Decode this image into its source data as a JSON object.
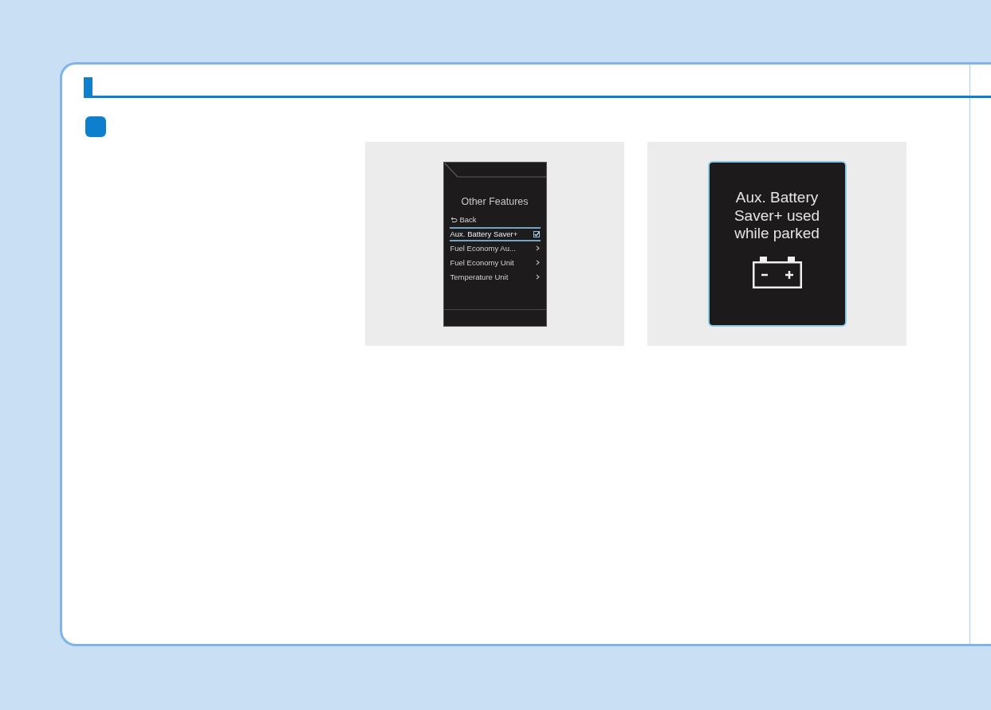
{
  "figures": [
    {
      "kind": "menu_screen",
      "title": "Other Features",
      "items": [
        {
          "kind": "back",
          "label": "Back",
          "selected": false
        },
        {
          "kind": "checkbox",
          "label": "Aux. Battery Saver+",
          "selected": true,
          "checked": true
        },
        {
          "kind": "submenu",
          "label": "Fuel Economy Au...",
          "selected": false
        },
        {
          "kind": "submenu",
          "label": "Fuel Economy Unit",
          "selected": false
        },
        {
          "kind": "submenu",
          "label": "Temperature Unit",
          "selected": false
        }
      ]
    },
    {
      "kind": "popup_screen",
      "message": "Aux. Battery\nSaver+ used\nwhile parked"
    }
  ]
}
